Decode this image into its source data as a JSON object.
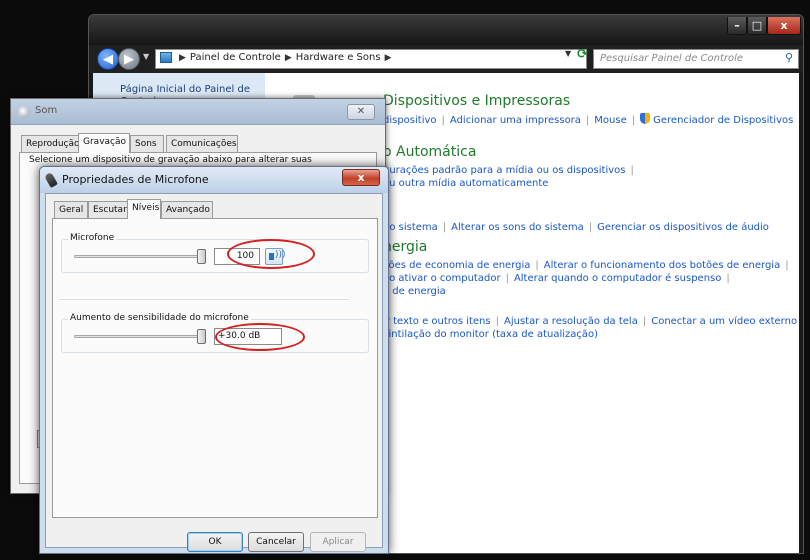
{
  "control_panel": {
    "breadcrumb": [
      "Painel de Controle",
      "Hardware e Sons"
    ],
    "search_placeholder": "Pesquisar Painel de Controle",
    "caption_buttons": {
      "minimize": "–",
      "maximize": "□",
      "close": "x"
    },
    "left_pane": {
      "home_link": "Página Inicial do Painel de Controle"
    },
    "sections": [
      {
        "title": "Dispositivos e Impressoras",
        "links": [
          "dispositivo",
          "Adicionar uma impressora",
          "Mouse",
          "Gerenciador de Dispositivos"
        ]
      },
      {
        "title": "o Automática",
        "links": [
          "gurações padrão para a mídia ou os dispositivos",
          "ou outra mídia automaticamente"
        ]
      },
      {
        "title": "",
        "links": [
          "do sistema",
          "Alterar os sons do sistema",
          "Gerenciar os dispositivos de áudio"
        ]
      },
      {
        "title": "nergia",
        "links": [
          "ções de economia de energia",
          "Alterar o funcionamento dos botões de energia",
          "ao ativar o computador",
          "Alterar quando o computador é suspenso",
          "o de energia"
        ]
      },
      {
        "title": "",
        "links": [
          "ir texto e outros itens",
          "Ajustar a resolução da tela",
          "Conectar a um vídeo externo",
          "cintilação do monitor (taxa de atualização)"
        ]
      }
    ]
  },
  "som_dialog": {
    "title": "Som",
    "close_label": "✕",
    "tabs": [
      "Reprodução",
      "Gravação",
      "Sons",
      "Comunicações"
    ],
    "active_tab": "Gravação",
    "instruction": "Selecione um dispositivo de gravação abaixo para alterar suas"
  },
  "mic_dialog": {
    "title": "Propriedades de Microfone",
    "close_label": "x",
    "tabs": [
      "Geral",
      "Escutar",
      "Níveis",
      "Avançado"
    ],
    "active_tab": "Níveis",
    "microphone": {
      "label": "Microfone",
      "value": "100",
      "level": 1.0
    },
    "boost": {
      "label": "Aumento de sensibilidade do microfone",
      "value": "+30.0 dB",
      "level": 1.0
    },
    "buttons": {
      "ok": "OK",
      "cancel": "Cancelar",
      "apply": "Aplicar"
    }
  },
  "colors": {
    "section_title": "#1f7a2a",
    "link": "#1a57c8",
    "annotation": "#d42020"
  }
}
